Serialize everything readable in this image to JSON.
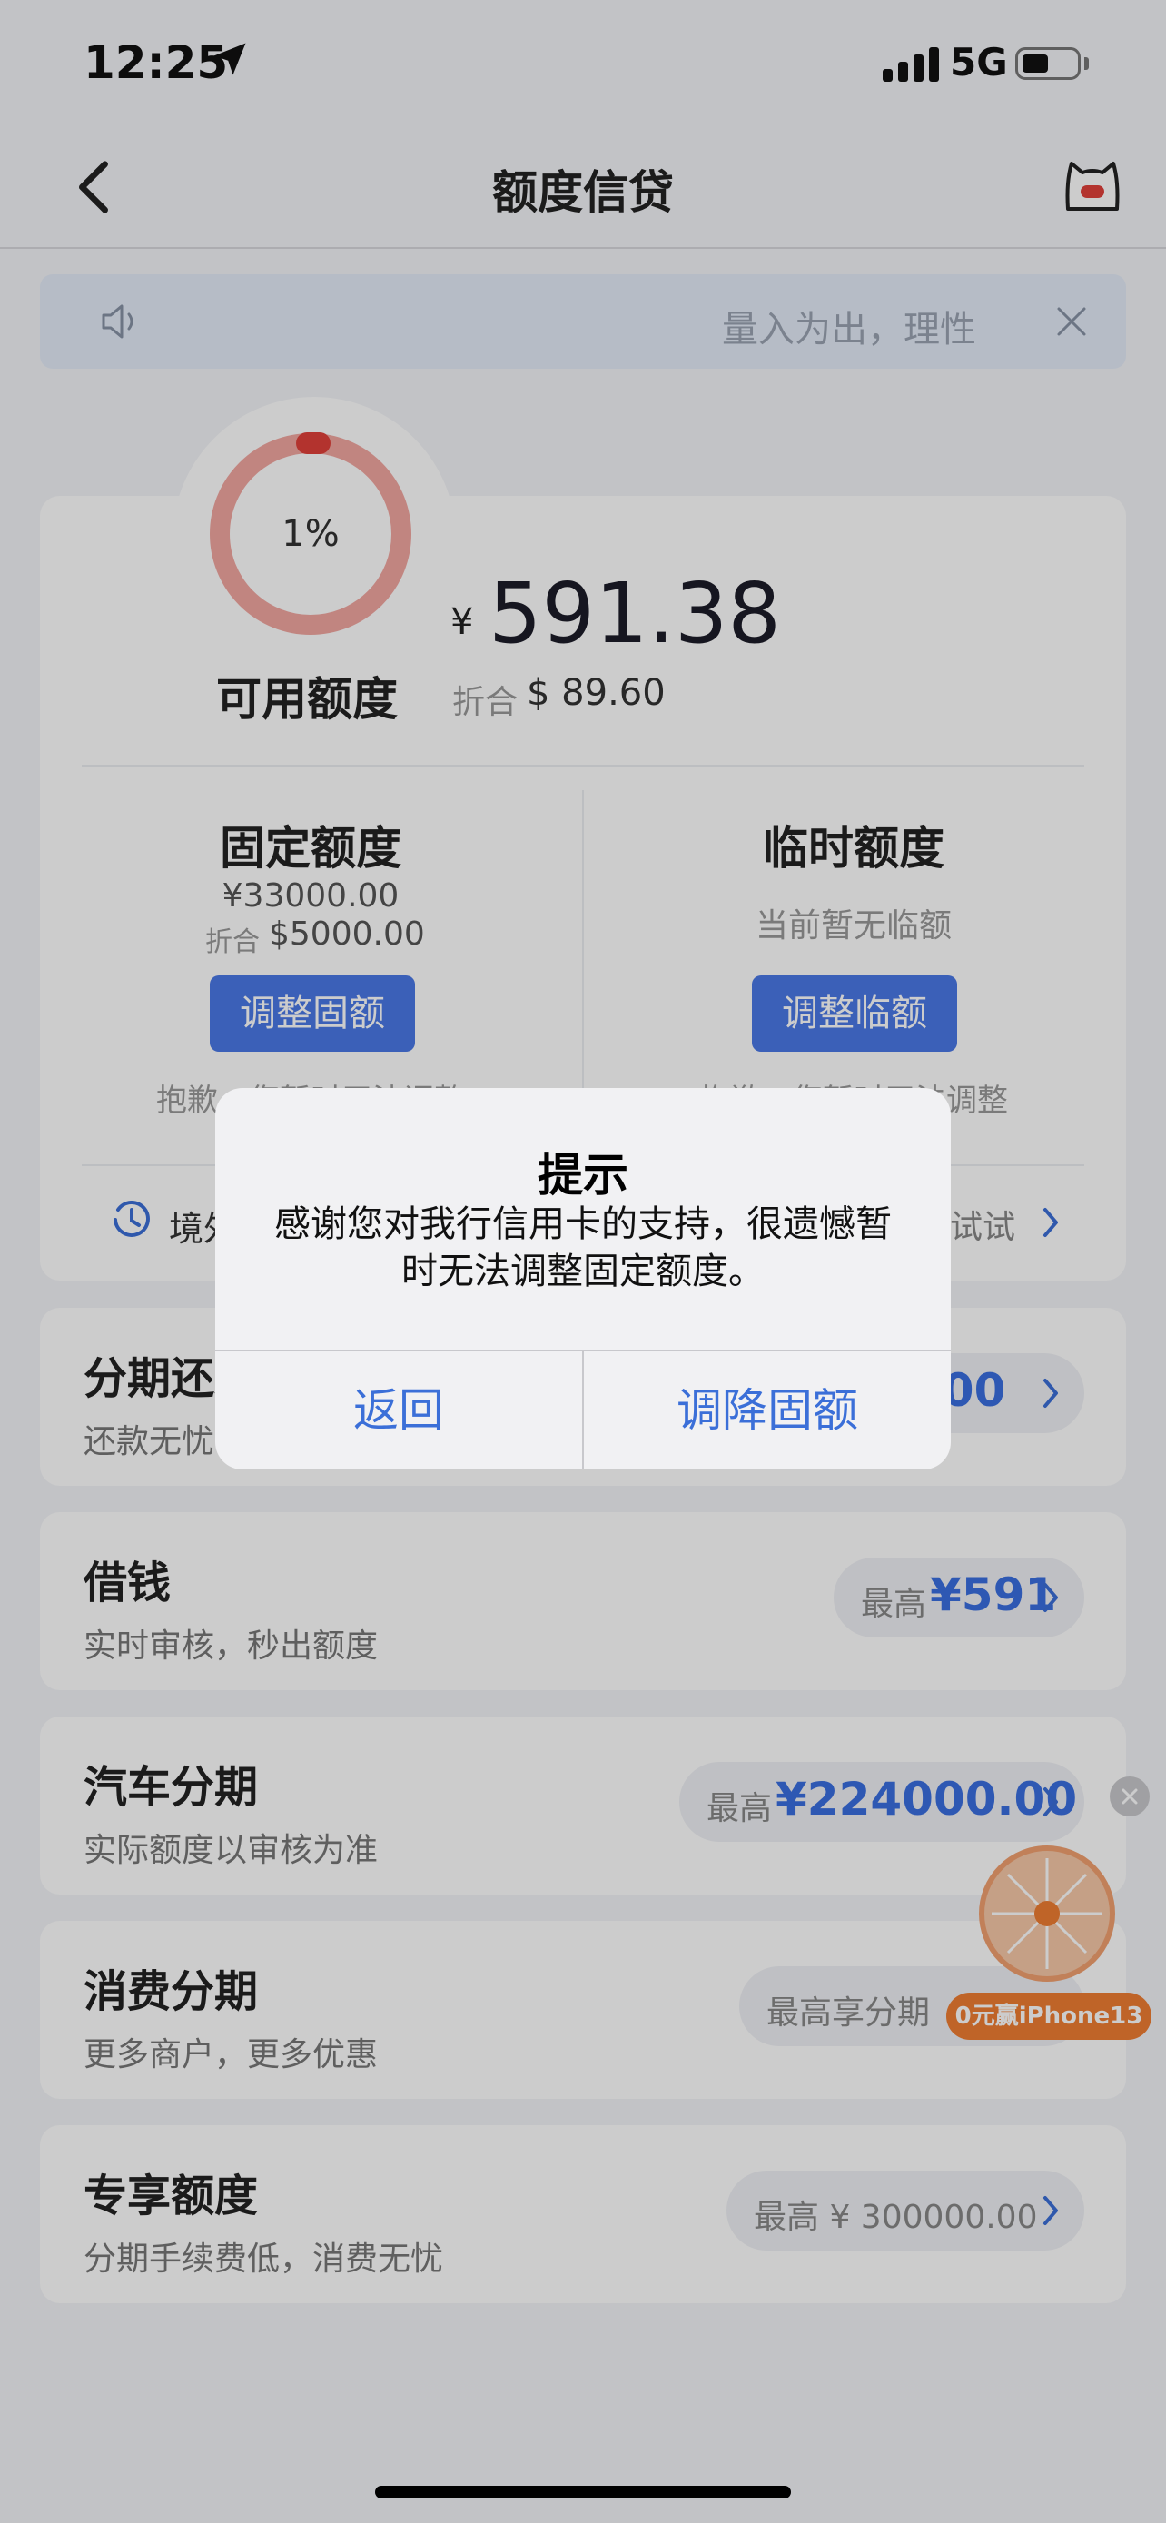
{
  "status_bar": {
    "time": "12:25",
    "network": "5G"
  },
  "nav": {
    "title": "额度信贷"
  },
  "notice": {
    "text": "量入为出，理性"
  },
  "credit_card": {
    "ring_percent": "1%",
    "ring_fraction": 0.01,
    "available_label": "可用额度",
    "currency_symbol": "¥",
    "available_amount": "591.38",
    "approx_label": "折合",
    "approx_value": "$ 89.60",
    "fixed": {
      "title": "固定额度",
      "amount": "¥33000.00",
      "approx_label": "折合",
      "approx_value": "$5000.00",
      "button": "调整固额",
      "note": "抱歉，您暂时无法调整"
    },
    "temp": {
      "title": "临时额度",
      "status": "当前暂无临额",
      "button": "调整临额",
      "note": "抱歉，您暂时无法调整"
    },
    "bottom_left": "境外",
    "bottom_right": "试试"
  },
  "rows": [
    {
      "title": "分期还款",
      "subtitle": "还款无忧",
      "pill_label": "",
      "pill_value": "0.00"
    },
    {
      "title": "借钱",
      "subtitle": "实时审核，秒出额度",
      "pill_label": "最高",
      "pill_value": "¥591"
    },
    {
      "title": "汽车分期",
      "subtitle": "实际额度以审核为准",
      "pill_label": "最高",
      "pill_value": "¥224000.00"
    },
    {
      "title": "消费分期",
      "subtitle": "更多商户，更多优惠",
      "pill_label": "最高享分期",
      "pill_value": ""
    },
    {
      "title": "专享额度",
      "subtitle": "分期手续费低，消费无忧",
      "pill_label": "最高 ¥ 300000.00",
      "pill_value": ""
    }
  ],
  "dialog": {
    "title": "提示",
    "message": "感谢您对我行信用卡的支持，很遗憾暂时无法调整固定额度。",
    "cancel": "返回",
    "confirm": "调降固额"
  },
  "promo": {
    "banner": "0元赢iPhone13"
  },
  "colors": {
    "accent": "#4a78e6",
    "ring": "#f2a7a1",
    "ring_indicator": "#e0403a",
    "promo": "#ef7d32"
  }
}
